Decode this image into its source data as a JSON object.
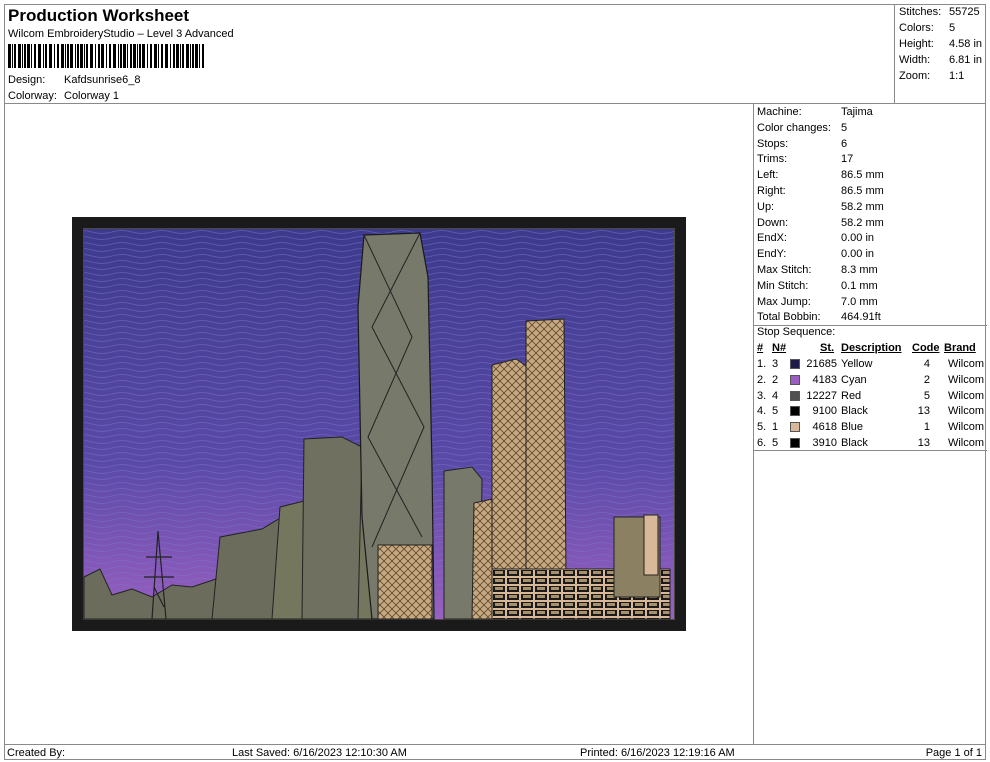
{
  "header": {
    "title": "Production Worksheet",
    "subtitle": "Wilcom EmbroideryStudio – Level 3 Advanced",
    "design_label": "Design:",
    "design_value": "Kafdsunrise6_8",
    "colorway_label": "Colorway:",
    "colorway_value": "Colorway 1"
  },
  "stats": [
    {
      "label": "Stitches:",
      "value": "55725"
    },
    {
      "label": "Colors:",
      "value": "5"
    },
    {
      "label": "Height:",
      "value": "4.58 in"
    },
    {
      "label": "Width:",
      "value": "6.81 in"
    },
    {
      "label": "Zoom:",
      "value": "1:1"
    }
  ],
  "machine_info": [
    {
      "label": "Machine:",
      "value": "Tajima"
    },
    {
      "label": "Color changes:",
      "value": "5"
    },
    {
      "label": "Stops:",
      "value": "6"
    },
    {
      "label": "Trims:",
      "value": "17"
    },
    {
      "label": "Left:",
      "value": "86.5 mm"
    },
    {
      "label": "Right:",
      "value": "86.5 mm"
    },
    {
      "label": "Up:",
      "value": "58.2 mm"
    },
    {
      "label": "Down:",
      "value": "58.2 mm"
    },
    {
      "label": "EndX:",
      "value": "0.00 in"
    },
    {
      "label": "EndY:",
      "value": "0.00 in"
    },
    {
      "label": "Max Stitch:",
      "value": "8.3 mm"
    },
    {
      "label": "Min Stitch:",
      "value": "0.1 mm"
    },
    {
      "label": "Max Jump:",
      "value": "7.0 mm"
    },
    {
      "label": "Total Bobbin:",
      "value": "464.91ft"
    }
  ],
  "stop_sequence": {
    "title": "Stop Sequence:",
    "headers": {
      "num": "#",
      "n": "N#",
      "st": "St.",
      "desc": "Description",
      "code": "Code",
      "brand": "Brand"
    },
    "rows": [
      {
        "num": "1.",
        "n": "3",
        "color": "#1e1a4a",
        "st": "21685",
        "desc": "Yellow",
        "code": "4",
        "brand": "Wilcom"
      },
      {
        "num": "2.",
        "n": "2",
        "color": "#9a5fc0",
        "st": "4183",
        "desc": "Cyan",
        "code": "2",
        "brand": "Wilcom"
      },
      {
        "num": "3.",
        "n": "4",
        "color": "#505050",
        "st": "12227",
        "desc": "Red",
        "code": "5",
        "brand": "Wilcom"
      },
      {
        "num": "4.",
        "n": "5",
        "color": "#000000",
        "st": "9100",
        "desc": "Black",
        "code": "13",
        "brand": "Wilcom"
      },
      {
        "num": "5.",
        "n": "1",
        "color": "#d8b898",
        "st": "4618",
        "desc": "Blue",
        "code": "1",
        "brand": "Wilcom"
      },
      {
        "num": "6.",
        "n": "5",
        "color": "#000000",
        "st": "3910",
        "desc": "Black",
        "code": "13",
        "brand": "Wilcom"
      }
    ]
  },
  "footer": {
    "created": "Created By:",
    "saved": "Last Saved: 6/16/2023 12:10:30 AM",
    "printed": "Printed: 6/16/2023 12:19:16 AM",
    "page": "Page 1 of 1"
  },
  "colors": {
    "sky_top": "#3d3a8c",
    "sky_bottom": "#9a5fc0",
    "building": "#6b6c5c",
    "gold": "#d8b898",
    "border": "#1a1a1a"
  }
}
